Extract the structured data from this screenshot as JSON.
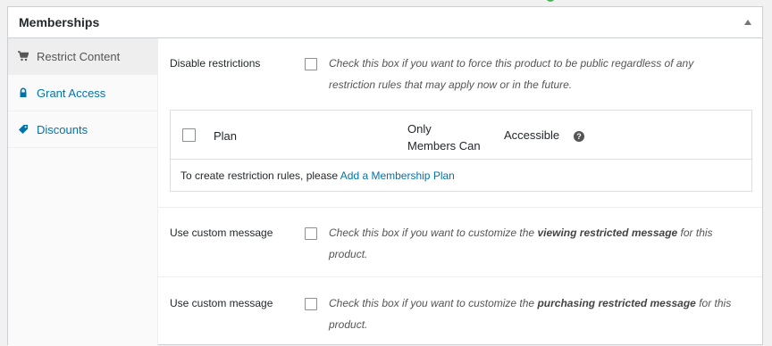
{
  "panel": {
    "title": "Memberships"
  },
  "tabs": [
    {
      "label": "Restrict Content",
      "icon": "cart-icon"
    },
    {
      "label": "Grant Access",
      "icon": "lock-icon"
    },
    {
      "label": "Discounts",
      "icon": "tag-icon"
    }
  ],
  "disable_restrictions": {
    "label": "Disable restrictions",
    "line1": "Check this box if you want to force this product to be public regardless of any",
    "line2": "restriction rules that may apply now or in the future."
  },
  "rules_table": {
    "col_plan": "Plan",
    "col_only_1": "Only",
    "col_only_2": "Members Can",
    "col_accessible": "Accessible",
    "help": "?",
    "empty_prefix": "To create restriction rules, please ",
    "empty_link": "Add a Membership Plan"
  },
  "custom_view": {
    "label": "Use custom message",
    "pre": "Check this box if you want to customize the ",
    "bold": "viewing restricted message",
    "post": " for this",
    "line2": "product."
  },
  "custom_purchase": {
    "label": "Use custom message",
    "pre": "Check this box if you want to customize the ",
    "bold": "purchasing restricted message",
    "post": " for this",
    "line2": "product."
  },
  "colors": {
    "link": "#0073aa",
    "active_tab_bg": "#eeeeee",
    "accent_dot": "#46b450"
  }
}
